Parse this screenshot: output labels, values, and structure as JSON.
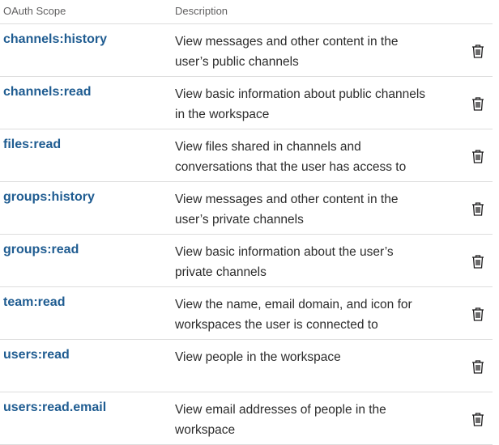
{
  "header": {
    "scope_label": "OAuth Scope",
    "description_label": "Description"
  },
  "icons": {
    "delete": "trash-icon"
  },
  "colors": {
    "scope_link": "#1f5c91",
    "divider": "#dddddd",
    "header_text": "#616061"
  },
  "rows": [
    {
      "scope": "channels:history",
      "description": "View messages and other content in the user’s public channels"
    },
    {
      "scope": "channels:read",
      "description": "View basic information about public channels in the workspace"
    },
    {
      "scope": "files:read",
      "description": "View files shared in channels and conversations that the user has access to"
    },
    {
      "scope": "groups:history",
      "description": "View messages and other content in the user’s private channels"
    },
    {
      "scope": "groups:read",
      "description": "View basic information about the user’s private channels"
    },
    {
      "scope": "team:read",
      "description": "View the name, email domain, and icon for workspaces the user is connected to"
    },
    {
      "scope": "users:read",
      "description": "View people in the workspace"
    },
    {
      "scope": "users:read.email",
      "description": "View email addresses of people in the workspace"
    }
  ]
}
